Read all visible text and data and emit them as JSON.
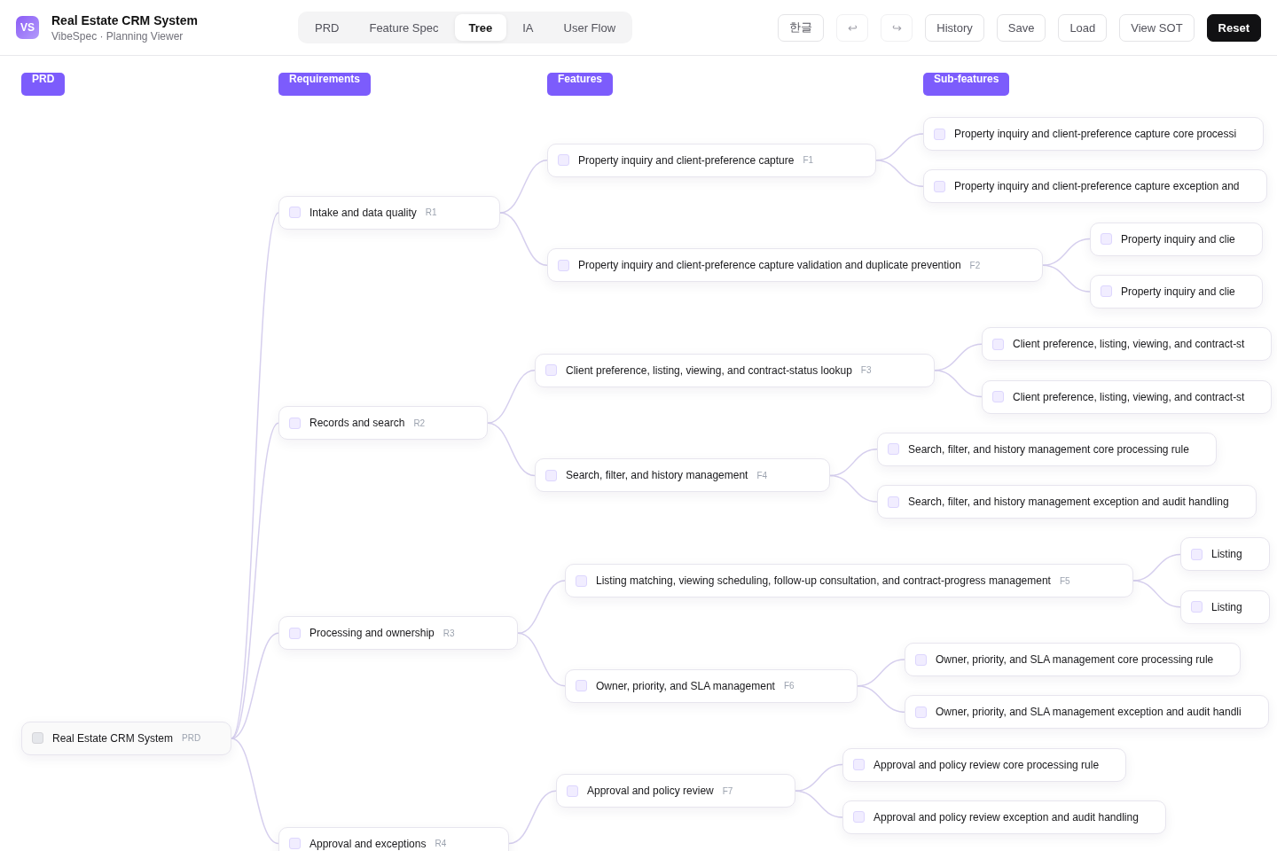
{
  "app": {
    "logo": "VS",
    "title": "Real Estate CRM System",
    "subtitle": "VibeSpec · Planning Viewer"
  },
  "tabs": [
    {
      "label": "PRD",
      "selected": false
    },
    {
      "label": "Feature Spec",
      "selected": false
    },
    {
      "label": "Tree",
      "selected": true
    },
    {
      "label": "IA",
      "selected": false
    },
    {
      "label": "User Flow",
      "selected": false
    }
  ],
  "toolbar": [
    {
      "label": "한글",
      "kind": "default",
      "disabled": false
    },
    {
      "label": "↩",
      "kind": "icon",
      "disabled": true
    },
    {
      "label": "↪",
      "kind": "icon",
      "disabled": true
    },
    {
      "label": "History",
      "kind": "default",
      "disabled": false
    },
    {
      "label": "Save",
      "kind": "default",
      "disabled": false
    },
    {
      "label": "Load",
      "kind": "default",
      "disabled": false
    },
    {
      "label": "View SOT",
      "kind": "default",
      "disabled": false
    },
    {
      "label": "Reset",
      "kind": "primary",
      "disabled": false
    }
  ],
  "columns": [
    "PRD",
    "Requirements",
    "Features",
    "Sub-features"
  ],
  "tree": {
    "label": "Real Estate CRM System",
    "tag": "PRD",
    "checked": false,
    "children": [
      {
        "label": "Intake and data quality",
        "tag": "R1",
        "checked": false,
        "children": [
          {
            "label": "Property inquiry and client-preference capture",
            "tag": "F1",
            "checked": false,
            "children": [
              {
                "label": "Property inquiry and client-preference capture core processi",
                "checked": false
              },
              {
                "label": "Property inquiry and client-preference capture exception and",
                "checked": false
              }
            ]
          },
          {
            "label": "Property inquiry and client-preference capture validation and duplicate prevention",
            "tag": "F2",
            "checked": false,
            "children": [
              {
                "label": "Property inquiry and clie",
                "checked": false
              },
              {
                "label": "Property inquiry and clie",
                "checked": false
              }
            ]
          }
        ]
      },
      {
        "label": "Records and search",
        "tag": "R2",
        "checked": false,
        "children": [
          {
            "label": "Client preference, listing, viewing, and contract-status lookup",
            "tag": "F3",
            "checked": false,
            "children": [
              {
                "label": "Client preference, listing, viewing, and contract-st",
                "checked": false
              },
              {
                "label": "Client preference, listing, viewing, and contract-st",
                "checked": false
              }
            ]
          },
          {
            "label": "Search, filter, and history management",
            "tag": "F4",
            "checked": false,
            "children": [
              {
                "label": "Search, filter, and history management core processing rule",
                "checked": false
              },
              {
                "label": "Search, filter, and history management exception and audit handling",
                "checked": false
              }
            ]
          }
        ]
      },
      {
        "label": "Processing and ownership",
        "tag": "R3",
        "checked": false,
        "children": [
          {
            "label": "Listing matching, viewing scheduling, follow-up consultation, and contract-progress management",
            "tag": "F5",
            "checked": false,
            "children": [
              {
                "label": "Listing",
                "checked": false
              },
              {
                "label": "Listing",
                "checked": false
              }
            ]
          },
          {
            "label": "Owner, priority, and SLA management",
            "tag": "F6",
            "checked": false,
            "children": [
              {
                "label": "Owner, priority, and SLA management core processing rule",
                "checked": false
              },
              {
                "label": "Owner, priority, and SLA management exception and audit handli",
                "checked": false
              }
            ]
          }
        ]
      },
      {
        "label": "Approval and exceptions",
        "tag": "R4",
        "checked": false,
        "children": [
          {
            "label": "Approval and policy review",
            "tag": "F7",
            "checked": false,
            "children": [
              {
                "label": "Approval and policy review core processing rule",
                "checked": false
              },
              {
                "label": "Approval and policy review exception and audit handling",
                "checked": false
              }
            ]
          }
        ]
      }
    ]
  }
}
